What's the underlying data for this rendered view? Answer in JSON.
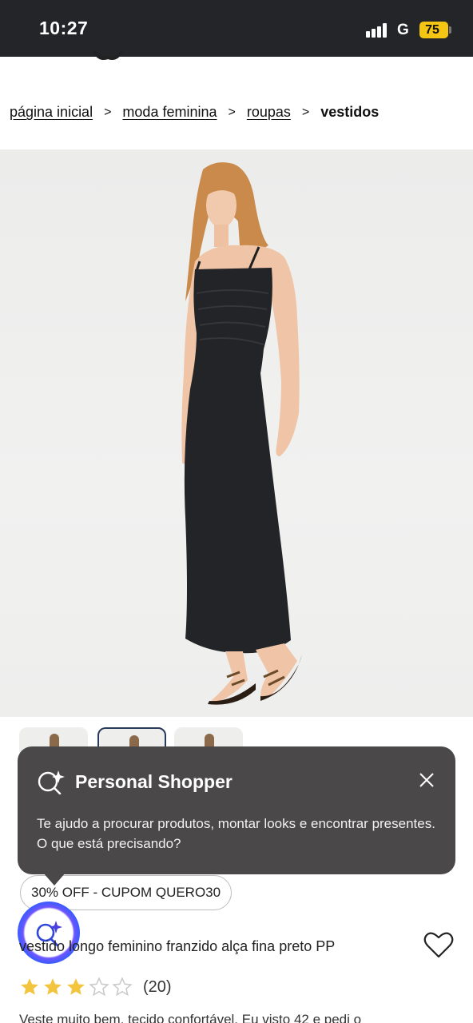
{
  "status_bar": {
    "time": "10:27",
    "carrier": "G",
    "battery": "75",
    "battery_color": "#f4c613",
    "background": "#232529"
  },
  "breadcrumb": {
    "items": [
      "página inicial",
      "moda feminina",
      "roupas"
    ],
    "separator": ">",
    "current": "vestidos"
  },
  "product_image": {
    "icon": "product-photo-woman-black-maxi-dress"
  },
  "thumbnails": {
    "count": 3,
    "active_index": 1
  },
  "personal_shopper": {
    "title": "Personal Shopper",
    "message": "Te ajudo a procurar produtos, montar looks e encontrar presentes. O que está precisando?",
    "icon": "sparkle-search-icon",
    "close_icon": "close-icon",
    "background": "#4a4848"
  },
  "coupon": {
    "label": "30% OFF - CUPOM QUERO30"
  },
  "product": {
    "title": "vestido longo feminino franzido alça fina preto PP",
    "rating": 3,
    "rating_max": 5,
    "review_count": "(20)",
    "star_color": "#f3c53f",
    "review_snippet": "Veste muito bem, tecido confortável. Eu visto 42 e pedi o"
  }
}
